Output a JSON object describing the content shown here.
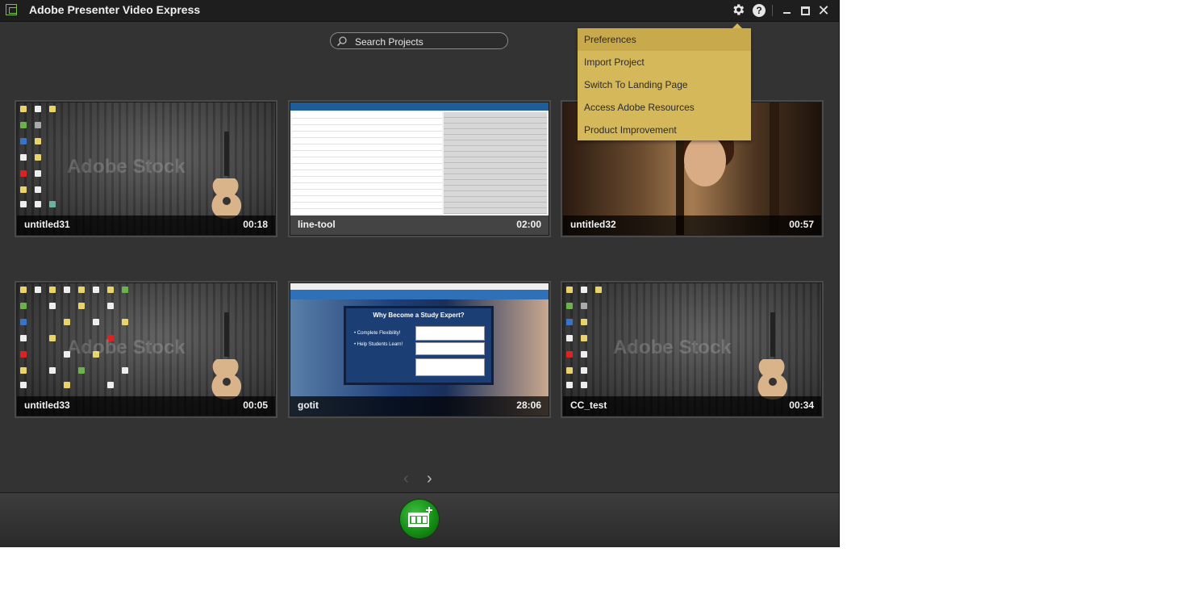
{
  "window": {
    "title": "Adobe Presenter Video Express",
    "icons": [
      "app-icon",
      "gear-icon",
      "help-icon",
      "minimize-icon",
      "maximize-icon",
      "close-icon"
    ]
  },
  "search": {
    "placeholder": "Search Projects"
  },
  "projects": [
    {
      "name": "untitled31",
      "duration": "00:18",
      "watermark": "Adobe Stock"
    },
    {
      "name": "line-tool",
      "duration": "02:00"
    },
    {
      "name": "untitled32",
      "duration": "00:57"
    },
    {
      "name": "untitled33",
      "duration": "00:05",
      "watermark": "Adobe Stock"
    },
    {
      "name": "gotit",
      "duration": "28:06",
      "modal_title": "Why Become a Study Expert?",
      "bullets": [
        "Complete Flexibility!",
        "Help Students Learn!"
      ]
    },
    {
      "name": "CC_test",
      "duration": "00:34",
      "watermark": "Adobe Stock"
    }
  ],
  "settings_menu": {
    "items": [
      {
        "label": "Preferences",
        "highlighted": true
      },
      {
        "label": "Import Project"
      },
      {
        "label": "Switch To Landing Page"
      },
      {
        "label": "Access Adobe Resources"
      },
      {
        "label": "Product Improvement"
      }
    ]
  },
  "pager": {
    "prev": "‹",
    "next": "›"
  },
  "colors": {
    "menu_bg": "#d5b85a",
    "new_button": "#1f9e1f",
    "app_bg": "#333333"
  }
}
